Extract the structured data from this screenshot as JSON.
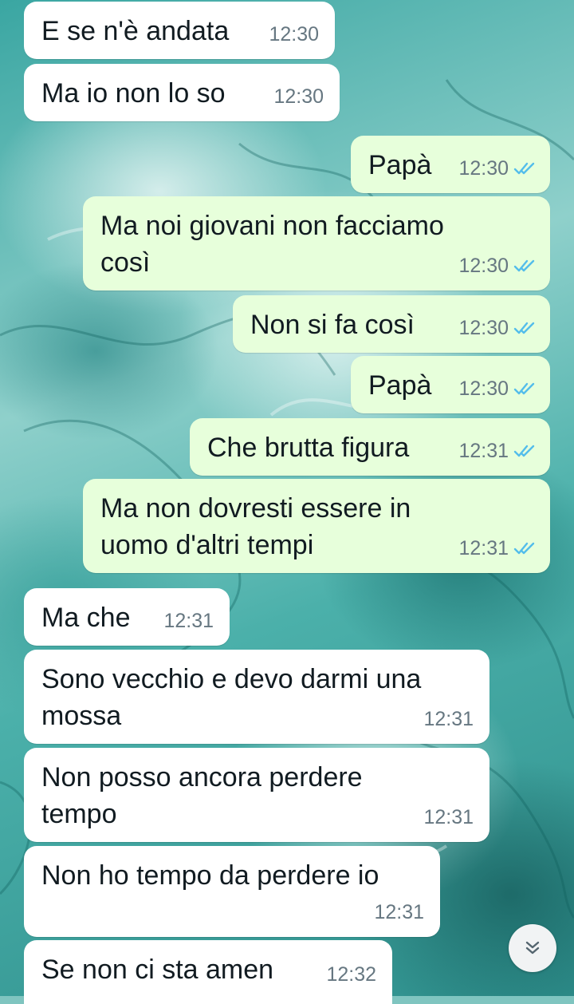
{
  "messages": [
    {
      "direction": "in",
      "text": "E se n'è andata",
      "time": "12:30"
    },
    {
      "direction": "in",
      "text": "Ma io non lo so",
      "time": "12:30"
    },
    {
      "direction": "out",
      "text": "Papà",
      "time": "12:30",
      "status": "read"
    },
    {
      "direction": "out",
      "text_line1": "Ma noi giovani non facciamo",
      "text_line2": "così",
      "time": "12:30",
      "status": "read"
    },
    {
      "direction": "out",
      "text": "Non si fa così",
      "time": "12:30",
      "status": "read"
    },
    {
      "direction": "out",
      "text": "Papà",
      "time": "12:30",
      "status": "read"
    },
    {
      "direction": "out",
      "text": "Che brutta figura",
      "time": "12:31",
      "status": "read"
    },
    {
      "direction": "out",
      "text_line1": "Ma non dovresti essere in",
      "text_line2": "uomo d'altri tempi",
      "time": "12:31",
      "status": "read"
    },
    {
      "direction": "in",
      "text": "Ma che",
      "time": "12:31"
    },
    {
      "direction": "in",
      "text_line1": "Sono vecchio e devo darmi una",
      "text_line2": "mossa",
      "time": "12:31"
    },
    {
      "direction": "in",
      "text_line1": "Non posso ancora perdere",
      "text_line2": "tempo",
      "time": "12:31"
    },
    {
      "direction": "in",
      "text": "Non ho tempo da perdere io",
      "time": "12:31"
    },
    {
      "direction": "in",
      "text": "Se non ci sta amen",
      "time": "12:32"
    }
  ],
  "icons": {
    "read_tick": "double-check-icon",
    "scroll_down": "double-chevron-down-icon"
  },
  "colors": {
    "incoming_bubble": "#ffffff",
    "outgoing_bubble": "#e7ffdb",
    "read_tick": "#53bdeb",
    "timestamp": "#667781"
  }
}
